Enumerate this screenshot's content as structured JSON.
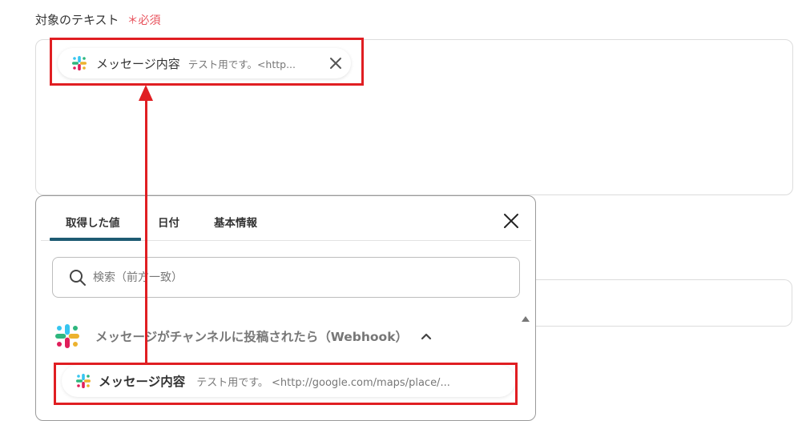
{
  "field": {
    "label": "対象のテキスト",
    "required_label": "＊必須"
  },
  "selected_chip": {
    "icon": "slack-icon",
    "name": "メッセージ内容",
    "value": "テスト用です。<http..."
  },
  "panel": {
    "tabs": [
      {
        "label": "取得した値",
        "active": true
      },
      {
        "label": "日付",
        "active": false
      },
      {
        "label": "基本情報",
        "active": false
      }
    ],
    "search": {
      "placeholder": "検索（前方一致）",
      "value": ""
    },
    "group": {
      "icon": "slack-icon",
      "label": "メッセージがチャンネルに投稿されたら（Webhook）",
      "expanded": true
    },
    "items": [
      {
        "icon": "slack-icon",
        "name": "メッセージ内容",
        "value": "テスト用です。 <http://google.com/maps/place/..."
      }
    ]
  },
  "colors": {
    "annotation_red": "#e01e22",
    "active_tab": "#1e5b73",
    "required": "#e8525c"
  }
}
